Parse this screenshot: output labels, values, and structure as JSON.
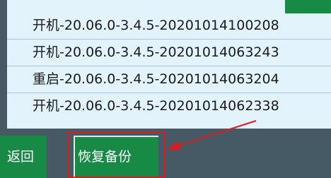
{
  "backup_list": {
    "items": [
      {
        "label": "开机-20.06.0-3.4.5-20201014100208"
      },
      {
        "label": "开机-20.06.0-3.4.5-20201014063243"
      },
      {
        "label": "重启-20.06.0-3.4.5-20201014063204"
      },
      {
        "label": "开机-20.06.0-3.4.5-20201014062338"
      }
    ]
  },
  "toolbar": {
    "back_label": "返回",
    "restore_label": "恢复备份"
  },
  "annotation": {
    "color": "#e0191c"
  },
  "colors": {
    "accent_green": "#178a45",
    "list_background": "#e2f3fb",
    "bar_background": "#455a64"
  }
}
